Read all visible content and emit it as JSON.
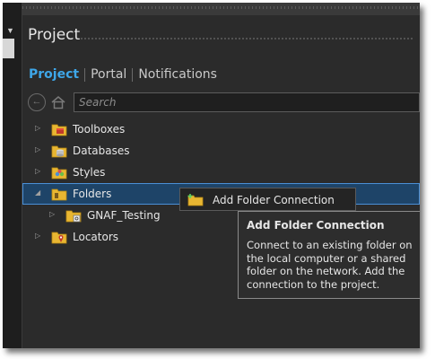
{
  "window": {
    "title": "Project"
  },
  "tabs": [
    {
      "label": "Project",
      "active": true
    },
    {
      "label": "Portal",
      "active": false
    },
    {
      "label": "Notifications",
      "active": false
    }
  ],
  "search": {
    "placeholder": "Search"
  },
  "tree": {
    "items": [
      {
        "label": "Toolboxes",
        "icon": "toolbox-folder-icon",
        "expanded": false
      },
      {
        "label": "Databases",
        "icon": "database-folder-icon",
        "expanded": false
      },
      {
        "label": "Styles",
        "icon": "styles-folder-icon",
        "expanded": false
      },
      {
        "label": "Folders",
        "icon": "folder-icon",
        "expanded": true,
        "selected": true
      },
      {
        "label": "GNAF_Testing",
        "icon": "folder-connection-icon",
        "expanded": false,
        "child": true
      },
      {
        "label": "Locators",
        "icon": "locators-folder-icon",
        "expanded": false
      }
    ]
  },
  "context_menu": {
    "items": [
      {
        "label": "Add Folder Connection",
        "icon": "add-folder-icon"
      }
    ]
  },
  "tooltip": {
    "title": "Add Folder Connection",
    "body": "Connect to an existing folder on the local computer or a shared folder on the network. Add the connection to the project."
  },
  "colors": {
    "background": "#2b2b2b",
    "accent": "#3ea6e8",
    "selection": "#1e4468",
    "folder": "#e8b632"
  }
}
